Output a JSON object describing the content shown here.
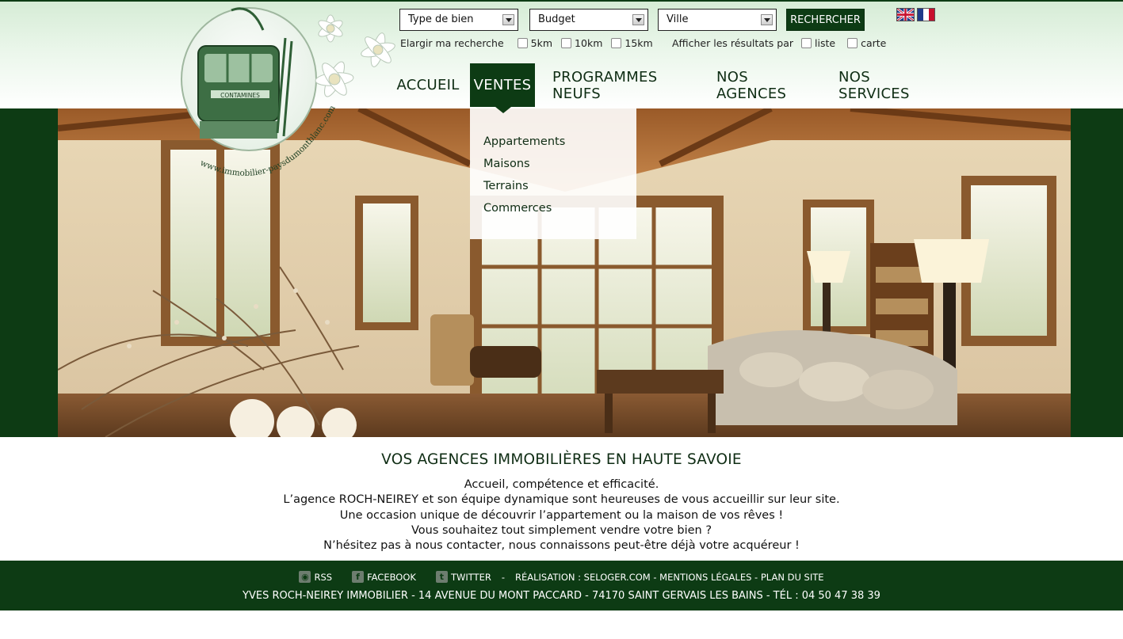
{
  "search": {
    "type_label": "Type de bien",
    "budget_label": "Budget",
    "city_label": "Ville",
    "submit_label": "RECHERCHER",
    "widen_label": "Elargir ma recherche",
    "radius_options": [
      "5km",
      "10km",
      "15km"
    ],
    "display_label": "Afficher les résultats par",
    "display_options": [
      "liste",
      "carte"
    ]
  },
  "languages": [
    "en-flag-icon",
    "fr-flag-icon"
  ],
  "logo": {
    "cabin_text": "CONTAMINES",
    "url_text": "www.immobilier-paysdumontblanc.com"
  },
  "nav": {
    "items": [
      {
        "label": "ACCUEIL",
        "active": false
      },
      {
        "label": "VENTES",
        "active": true
      },
      {
        "label": "PROGRAMMES NEUFS",
        "active": false
      },
      {
        "label": "NOS AGENCES",
        "active": false
      },
      {
        "label": "NOS SERVICES",
        "active": false
      }
    ],
    "ventes_submenu": [
      "Appartements",
      "Maisons",
      "Terrains",
      "Commerces"
    ]
  },
  "intro": {
    "title": "VOS AGENCES IMMOBILIÈRES EN HAUTE SAVOIE",
    "lines": [
      "Accueil, compétence et efficacité.",
      "L’agence ROCH-NEIREY et son équipe dynamique sont heureuses de vous accueillir sur leur site.",
      "Une occasion unique de découvrir l’appartement ou la maison de vos rêves !",
      "Vous souhaitez tout simplement vendre votre bien ?",
      "N’hésitez pas à nous contacter, nous connaissons peut-être déjà votre acquéreur !"
    ]
  },
  "footer": {
    "rss": "RSS",
    "facebook": "FACEBOOK",
    "twitter": "TWITTER",
    "separator": "-",
    "credits": "RÉALISATION : SELOGER.COM - MENTIONS LÉGALES - PLAN DU SITE",
    "address": "YVES ROCH-NEIREY IMMOBILIER - 14 AVENUE DU MONT PACCARD - 74170 SAINT GERVAIS LES BAINS - TÉL : 04 50 47 38 39"
  },
  "colors": {
    "brand_green": "#0d3b14",
    "header_tint": "#d6ecd6",
    "text": "#0f2d14"
  }
}
